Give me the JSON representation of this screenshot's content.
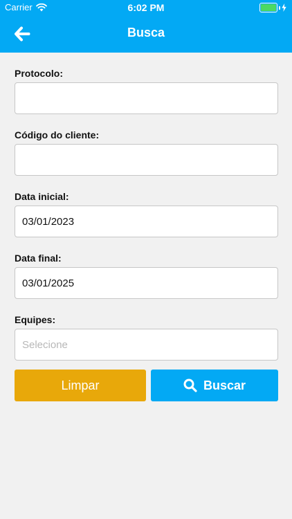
{
  "status_bar": {
    "carrier": "Carrier",
    "time": "6:02 PM",
    "battery_color": "#4cd964"
  },
  "header": {
    "title": "Busca",
    "back_icon": "arrow-left-icon",
    "background": "#03a9f4"
  },
  "form": {
    "protocolo": {
      "label": "Protocolo:",
      "value": ""
    },
    "codigo_cliente": {
      "label": "Código do cliente:",
      "value": ""
    },
    "data_inicial": {
      "label": "Data inicial:",
      "value": "03/01/2023"
    },
    "data_final": {
      "label": "Data final:",
      "value": "03/01/2025"
    },
    "equipes": {
      "label": "Equipes:",
      "placeholder": "Selecione"
    }
  },
  "actions": {
    "clear_label": "Limpar",
    "clear_color": "#e8a80a",
    "search_label": "Buscar",
    "search_icon": "search-icon",
    "search_color": "#03a9f4"
  }
}
